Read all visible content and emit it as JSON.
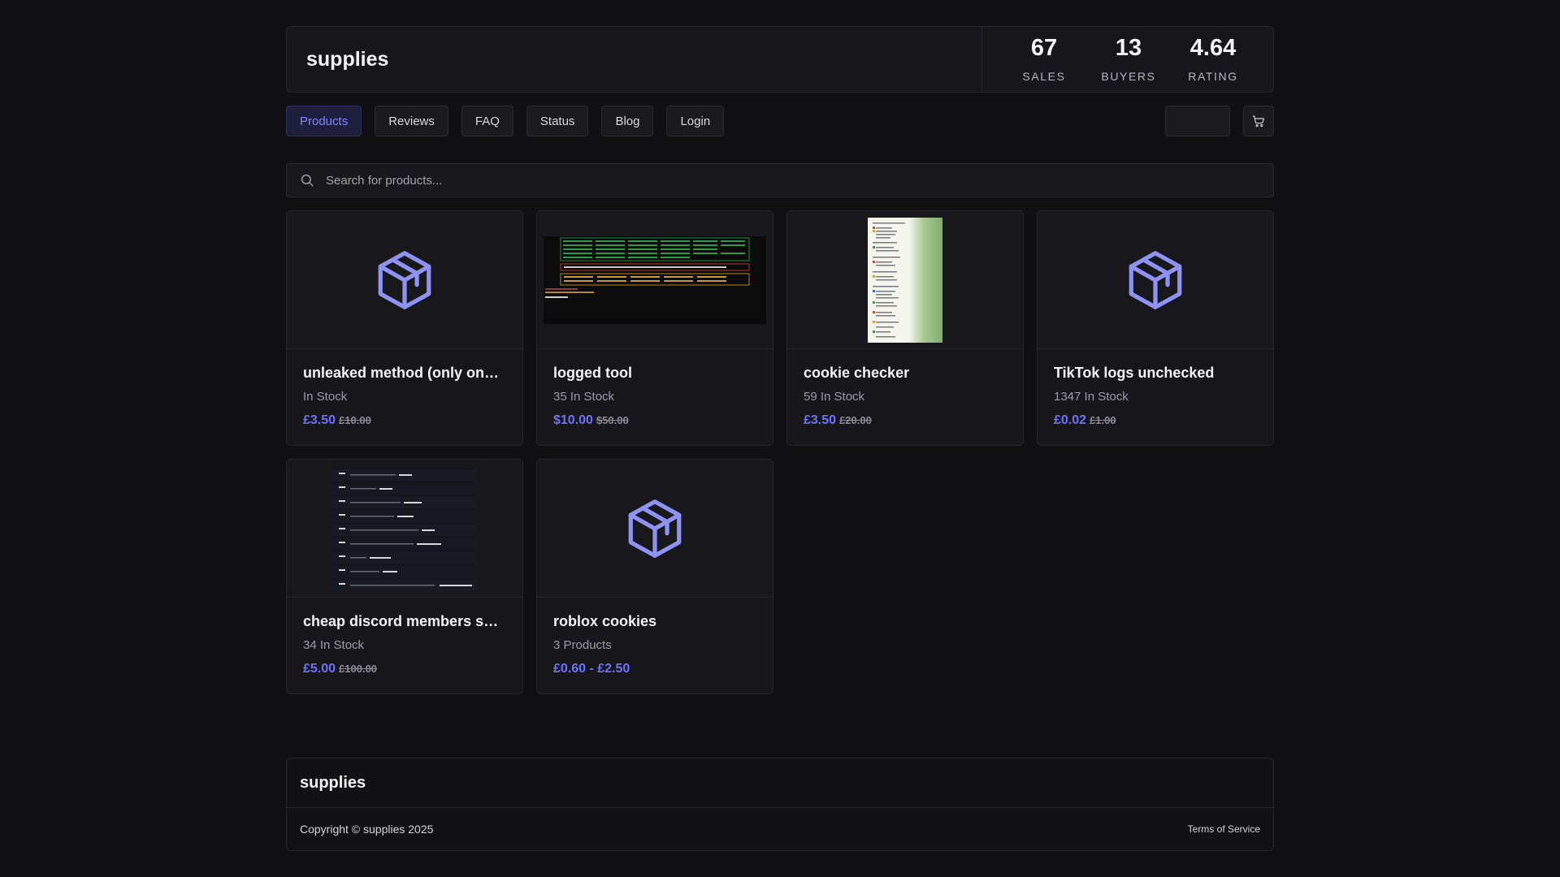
{
  "store": {
    "name": "supplies"
  },
  "stats": [
    {
      "value": "67",
      "label": "SALES"
    },
    {
      "value": "13",
      "label": "BUYERS"
    },
    {
      "value": "4.64",
      "label": "RATING"
    }
  ],
  "nav": {
    "items": [
      "Products",
      "Reviews",
      "FAQ",
      "Status",
      "Blog",
      "Login"
    ],
    "active": "Products",
    "cart_icon": "cart-icon"
  },
  "search": {
    "placeholder": "Search for products...",
    "icon": "search-icon"
  },
  "products": [
    {
      "title": "unleaked method (only on…",
      "stock": "In Stock",
      "price": "£3.50",
      "old_price": "£10.00",
      "image": "box-icon"
    },
    {
      "title": "logged tool",
      "stock": "35 In Stock",
      "price": "$10.00",
      "old_price": "$50.00",
      "image": "terminal-screenshot"
    },
    {
      "title": "cookie checker",
      "stock": "59 In Stock",
      "price": "£3.50",
      "old_price": "£20.00",
      "image": "checker-screenshot"
    },
    {
      "title": "TikTok logs unchecked",
      "stock": "1347 In Stock",
      "price": "£0.02",
      "old_price": "£1.00",
      "image": "box-icon"
    },
    {
      "title": "cheap discord members s…",
      "stock": "34 In Stock",
      "price": "£5.00",
      "old_price": "£100.00",
      "image": "discord-screenshot"
    },
    {
      "title": "roblox cookies",
      "stock": "3 Products",
      "price": "£0.60 - £2.50",
      "old_price": "",
      "image": "box-icon"
    }
  ],
  "footer": {
    "brand": "supplies",
    "copyright": "Copyright © supplies 2025",
    "tos": "Terms of Service"
  },
  "colors": {
    "accent": "#6d73f6",
    "background": "#101012",
    "card": "#17171b"
  }
}
